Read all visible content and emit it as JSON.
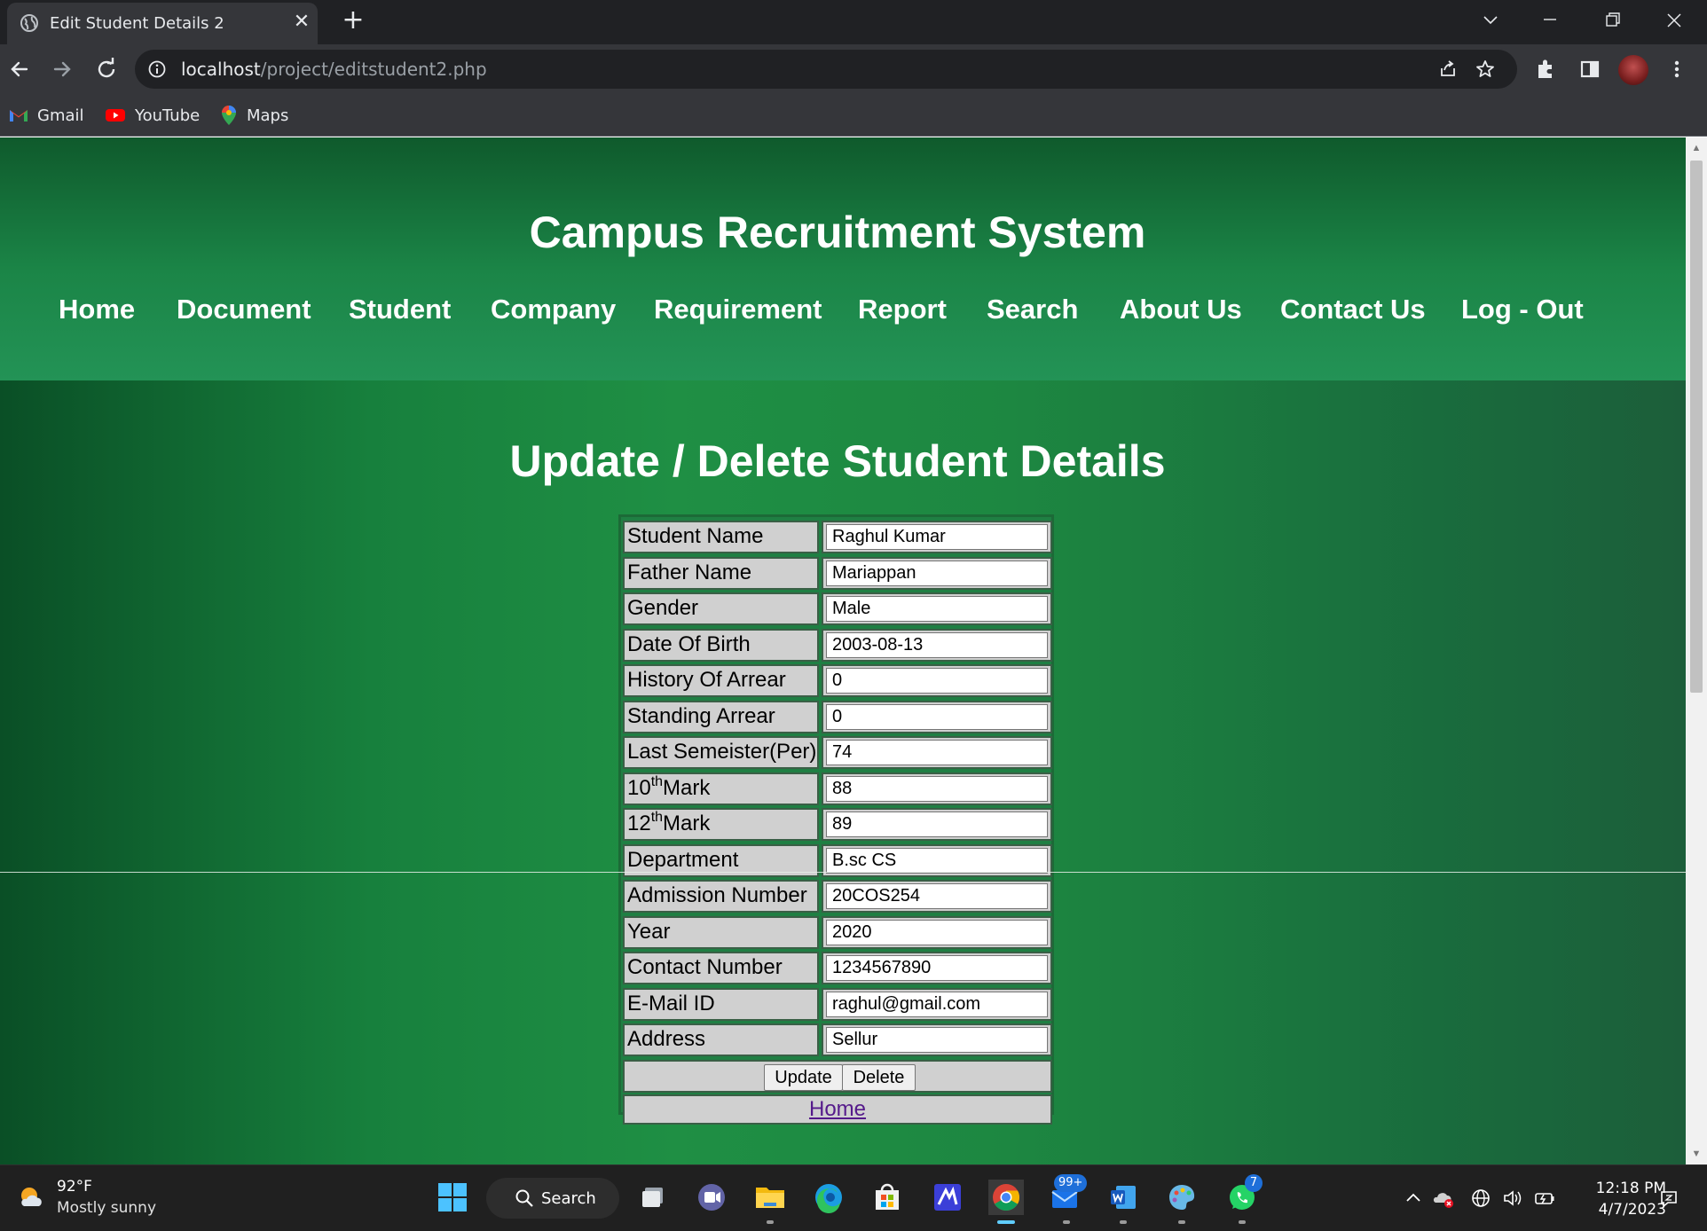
{
  "browser": {
    "tab_title": "Edit Student Details 2",
    "url_host": "localhost",
    "url_path": "/project/editstudent2.php",
    "bookmarks": [
      {
        "label": "Gmail",
        "icon": "gmail-icon"
      },
      {
        "label": "YouTube",
        "icon": "youtube-icon"
      },
      {
        "label": "Maps",
        "icon": "maps-icon"
      }
    ]
  },
  "site": {
    "title": "Campus Recruitment System",
    "nav": [
      "Home",
      "Document",
      "Student",
      "Company",
      "Requirement",
      "Report",
      "Search",
      "About Us",
      "Contact Us",
      "Log - Out"
    ]
  },
  "page": {
    "heading": "Update / Delete Student Details"
  },
  "form": {
    "fields": [
      {
        "label": "Student Name",
        "value": "Raghul Kumar"
      },
      {
        "label": "Father Name",
        "value": "Mariappan"
      },
      {
        "label": "Gender",
        "value": "Male"
      },
      {
        "label": "Date Of Birth",
        "value": "2003-08-13"
      },
      {
        "label": "History Of Arrear",
        "value": "0"
      },
      {
        "label": "Standing Arrear",
        "value": "0"
      },
      {
        "label": "Last Semeister(Per)",
        "value": "74"
      },
      {
        "label_pre": "10",
        "label_sup": "th",
        "label_post": "Mark",
        "value": "88"
      },
      {
        "label_pre": "12",
        "label_sup": "th",
        "label_post": "Mark",
        "value": "89"
      },
      {
        "label": "Department",
        "value": "B.sc CS"
      },
      {
        "label": "Admission Number",
        "value": "20COS254"
      },
      {
        "label": "Year",
        "value": "2020"
      },
      {
        "label": "Contact Number",
        "value": "1234567890"
      },
      {
        "label": "E-Mail ID",
        "value": "raghul@gmail.com"
      },
      {
        "label": "Address",
        "value": "Sellur"
      }
    ],
    "update_label": "Update",
    "delete_label": "Delete",
    "home_link": "Home"
  },
  "taskbar": {
    "weather_temp": "92°F",
    "weather_desc": "Mostly sunny",
    "search_label": "Search",
    "mail_badge": "99+",
    "whatsapp_badge": "7",
    "time": "12:18 PM",
    "date": "4/7/2023"
  },
  "colors": {
    "header_green": "#1b8547",
    "page_green": "#1f8f44",
    "form_cell": "#d0d0d0",
    "link_visited": "#551a8b"
  }
}
